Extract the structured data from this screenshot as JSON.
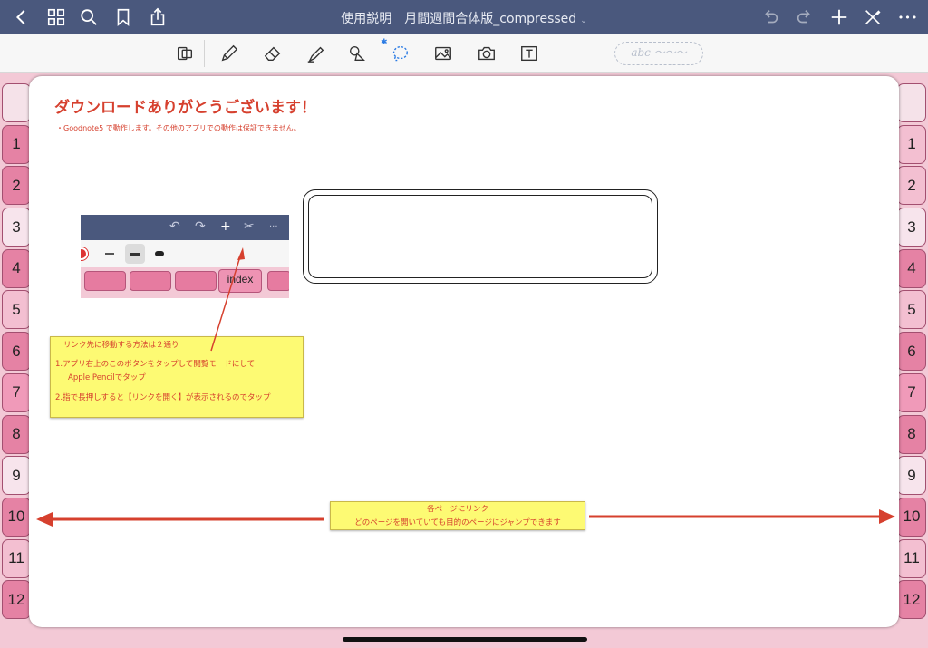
{
  "topbar": {
    "title": "使用説明　月間週間合体版_compressed",
    "title_chevron": "⌄",
    "left_icons": [
      "back-chevron-icon",
      "grid-thumbnails-icon",
      "search-icon",
      "bookmark-icon",
      "share-icon"
    ],
    "right_icons": [
      "undo-icon",
      "redo-icon",
      "add-page-icon",
      "read-mode-icon",
      "more-icon"
    ],
    "more_label": "•••"
  },
  "toolbar": {
    "tools": [
      "document-scan-icon",
      "pen-icon",
      "eraser-icon",
      "highlighter-icon",
      "shapes-icon",
      "lasso-icon",
      "image-icon",
      "camera-icon",
      "text-icon"
    ],
    "bluetooth_mark": "✱",
    "handwriting_placeholder": "abc ～～～"
  },
  "tabs": {
    "left": [
      "1",
      "2",
      "3",
      "4",
      "5",
      "6",
      "7",
      "8",
      "9",
      "10",
      "11",
      "12"
    ],
    "right": [
      "1",
      "2",
      "3",
      "4",
      "5",
      "6",
      "7",
      "8",
      "9",
      "10",
      "11",
      "12"
    ]
  },
  "page": {
    "heading": "ダウンロードありがとうございます！",
    "note": "・Goodnote5 で動作します。その他のアプリでの動作は保証できません。",
    "mini_screenshot": {
      "icons": [
        "↶",
        "↷",
        "+",
        "✂",
        "···"
      ],
      "index_label": "index"
    },
    "yellow_note_1": {
      "line1": "リンク先に移動する方法は２通り",
      "line2": "1.アプリ右上のこのボタンをタップして閲覧モードにして",
      "line3": "Apple Pencilでタップ",
      "line4": "2.指で長押しすると【リンクを開く】が表示されるのでタップ"
    },
    "yellow_note_2": {
      "line1": "各ページにリンク",
      "line2": "どのページを開いていても目的のページにジャンプできます"
    }
  },
  "colors": {
    "navbar": "#4a587d",
    "accent_red": "#d6402e",
    "tab_pink": "#f3c9d6",
    "tab_dark": "#e06b94",
    "note_yellow": "#fdfa73"
  }
}
